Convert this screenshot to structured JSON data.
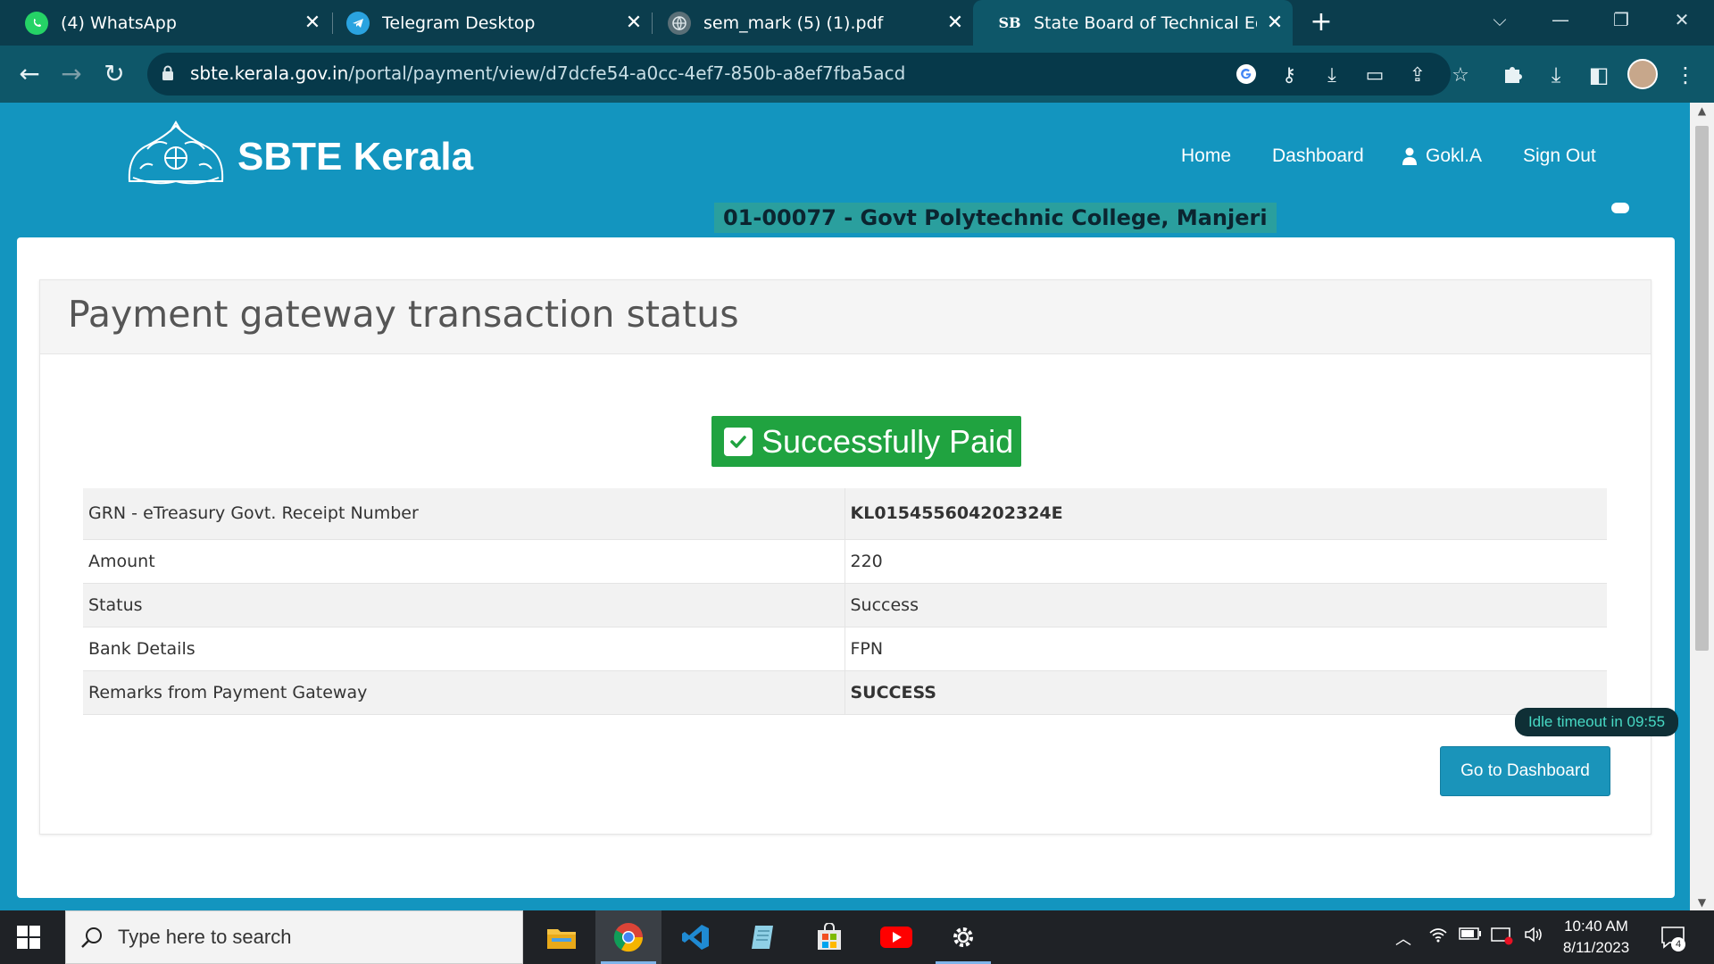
{
  "browser": {
    "tabs": [
      {
        "label": "(4) WhatsApp",
        "icon": "whatsapp-icon"
      },
      {
        "label": "Telegram Desktop",
        "icon": "telegram-icon"
      },
      {
        "label": "sem_mark (5) (1).pdf",
        "icon": "globe-icon"
      },
      {
        "label": "State Board of Technical Education",
        "icon": "sbte-favicon",
        "favicon_text": "SB",
        "active": true
      }
    ],
    "url_domain": "sbte.kerala.gov.in",
    "url_path": "/portal/payment/view/d7dcfe54-a0cc-4ef7-850b-a8ef7fba5acd"
  },
  "header": {
    "brand": "SBTE Kerala",
    "nav": {
      "home": "Home",
      "dashboard": "Dashboard",
      "user": "Gokl.A",
      "sign_out": "Sign Out"
    },
    "college": "01-00077 - Govt Polytechnic College, Manjeri"
  },
  "payment": {
    "title": "Payment gateway transaction status",
    "status_banner": "Successfully Paid",
    "rows": [
      {
        "label": "GRN - eTreasury Govt. Receipt Number",
        "value": "KL015455604202324E"
      },
      {
        "label": "Amount",
        "value": "220"
      },
      {
        "label": "Status",
        "value": "Success"
      },
      {
        "label": "Bank Details",
        "value": "FPN"
      },
      {
        "label": "Remarks from Payment Gateway",
        "value": "SUCCESS"
      }
    ],
    "dashboard_button": "Go to Dashboard"
  },
  "idle": "Idle timeout in 09:55",
  "taskbar": {
    "search_placeholder": "Type here to search",
    "time": "10:40 AM",
    "date": "8/11/2023",
    "notifications": "4"
  },
  "colors": {
    "page_bg": "#1395bf",
    "success": "#20a340",
    "button": "#1a94ba",
    "college_badge": "#2a9f9e",
    "chrome_dark": "#0b3d4d",
    "chrome_toolbar": "#0e5769"
  }
}
